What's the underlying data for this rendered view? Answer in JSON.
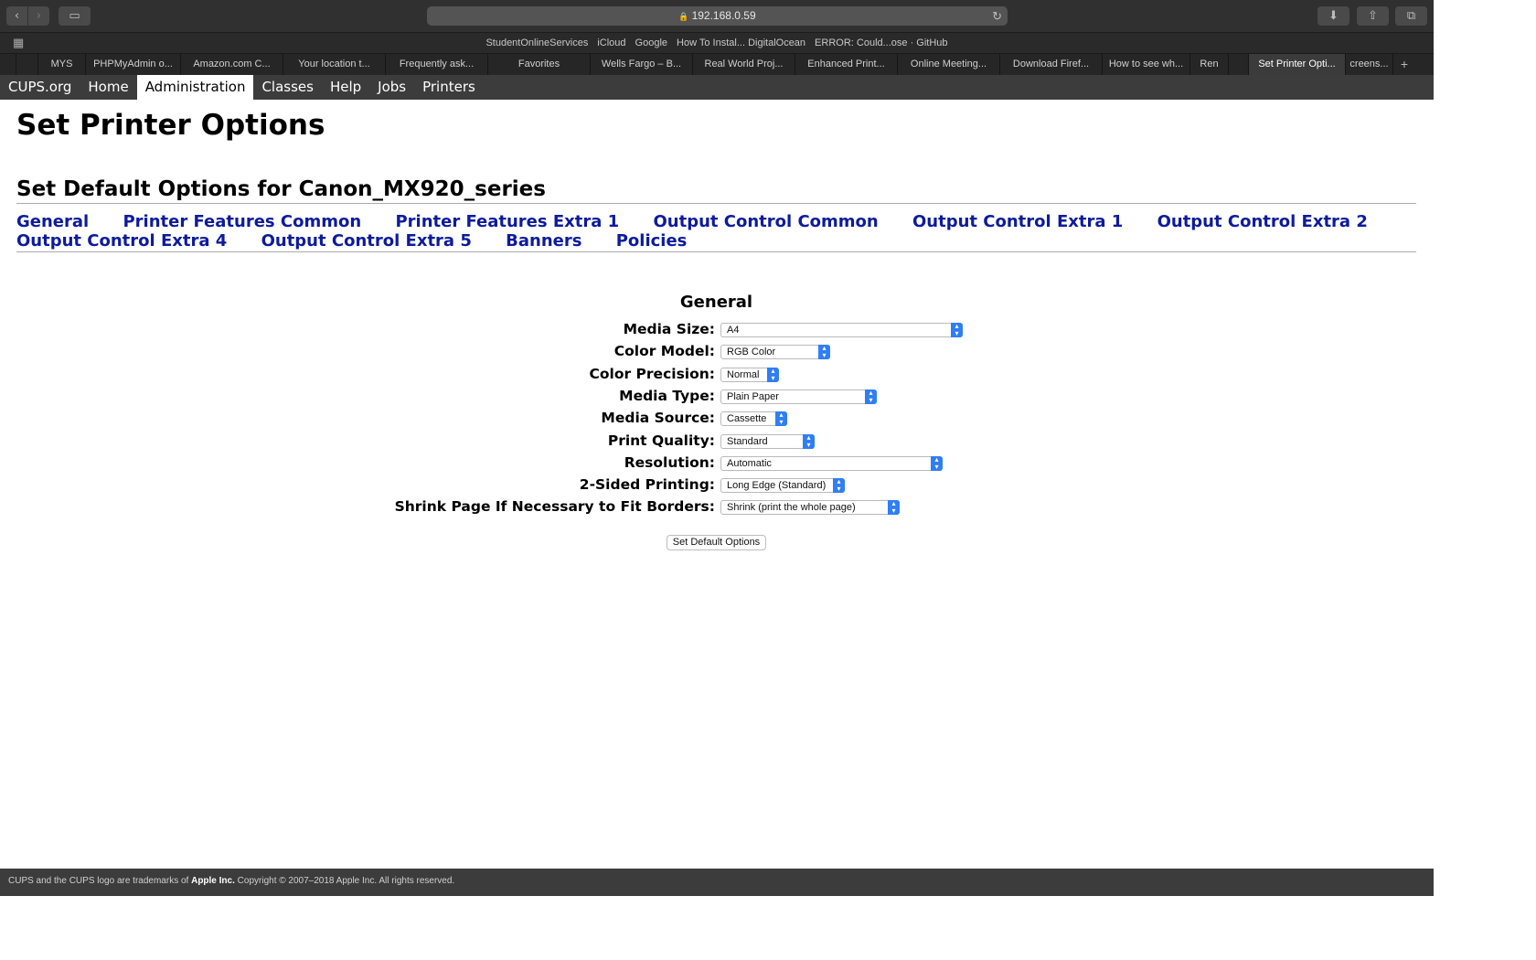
{
  "browser": {
    "address": "192.168.0.59",
    "favorites": [
      "StudentOnlineServices",
      "iCloud",
      "Google",
      "How To Instal... DigitalOcean",
      "ERROR: Could...ose · GitHub"
    ],
    "tabs": [
      {
        "label": "",
        "width": 18
      },
      {
        "label": "",
        "width": 24
      },
      {
        "label": "MYS",
        "width": 52
      },
      {
        "label": "PHPMyAdmin o...",
        "width": 104
      },
      {
        "label": "Amazon.com C...",
        "width": 112
      },
      {
        "label": "Your location t...",
        "width": 112
      },
      {
        "label": "Frequently ask...",
        "width": 112
      },
      {
        "label": "Favorites",
        "width": 112
      },
      {
        "label": "Wells Fargo – B...",
        "width": 112
      },
      {
        "label": "Real World Proj...",
        "width": 112
      },
      {
        "label": "Enhanced Print...",
        "width": 112
      },
      {
        "label": "Online Meeting...",
        "width": 112
      },
      {
        "label": "Download Firef...",
        "width": 112
      },
      {
        "label": "How to see wh...",
        "width": 96
      },
      {
        "label": "Ren",
        "width": 42
      },
      {
        "label": "",
        "width": 22
      },
      {
        "label": "Set Printer Opti...",
        "width": 106
      },
      {
        "label": "creens...",
        "width": 52
      }
    ],
    "active_tab": 16
  },
  "cups_nav": [
    "CUPS.org",
    "Home",
    "Administration",
    "Classes",
    "Help",
    "Jobs",
    "Printers"
  ],
  "cups_nav_selected": "Administration",
  "page": {
    "title": "Set Printer Options",
    "subtitle": "Set Default Options for Canon_MX920_series",
    "sections": [
      "General",
      "Printer Features Common",
      "Printer Features Extra 1",
      "Output Control Common",
      "Output Control Extra 1",
      "Output Control Extra 2",
      "Output Control Extra 4",
      "Output Control Extra 5",
      "Banners",
      "Policies"
    ]
  },
  "form": {
    "title": "General",
    "fields": [
      {
        "label": "Media Size:",
        "value": "A4"
      },
      {
        "label": "Color Model:",
        "value": "RGB Color"
      },
      {
        "label": "Color Precision:",
        "value": "Normal"
      },
      {
        "label": "Media Type:",
        "value": "Plain Paper"
      },
      {
        "label": "Media Source:",
        "value": "Cassette"
      },
      {
        "label": "Print Quality:",
        "value": "Standard"
      },
      {
        "label": "Resolution:",
        "value": "Automatic"
      },
      {
        "label": "2-Sided Printing:",
        "value": "Long Edge (Standard)"
      },
      {
        "label": "Shrink Page If Necessary to Fit Borders:",
        "value": "Shrink (print the whole page)"
      }
    ],
    "submit_label": "Set Default Options"
  },
  "footer": {
    "prefix": "CUPS and the CUPS logo are trademarks of ",
    "brand": "Apple Inc.",
    "suffix": " Copyright © 2007–2018 Apple Inc. All rights reserved."
  },
  "colors": {
    "link": "#0d1b9c",
    "nav_bg": "#3c3c3c",
    "select_arrow": "#2f7ef5"
  }
}
